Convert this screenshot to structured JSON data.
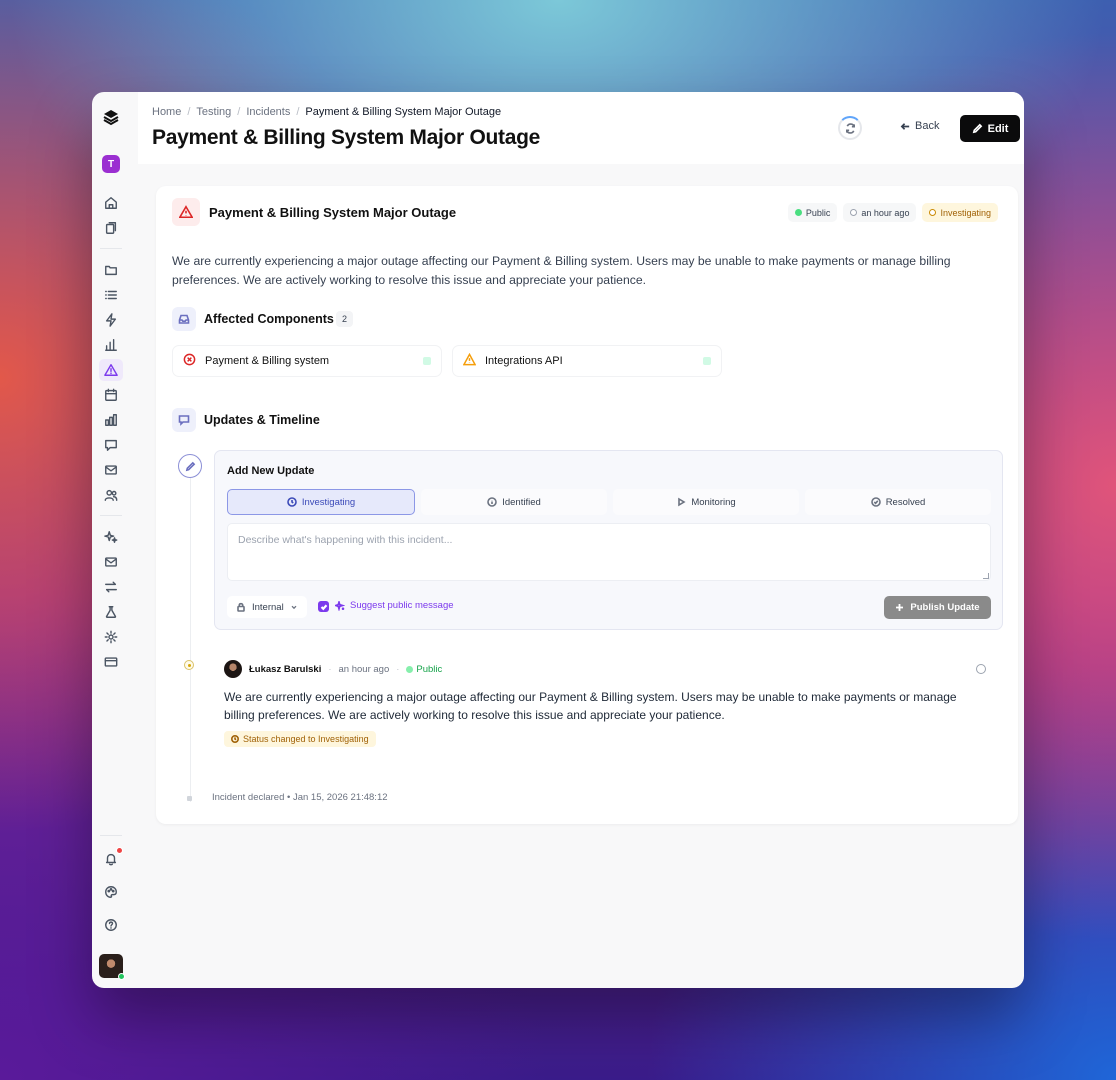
{
  "breadcrumb": [
    "Home",
    "Testing",
    "Incidents",
    "Payment & Billing System Major Outage"
  ],
  "page_title": "Payment & Billing System Major Outage",
  "header": {
    "back_label": "Back",
    "edit_label": "Edit"
  },
  "workspace_initial": "T",
  "incident": {
    "title": "Payment & Billing System Major Outage",
    "visibility": "Public",
    "time_ago": "an hour ago",
    "status": "Investigating",
    "description": "We are currently experiencing a major outage affecting our Payment & Billing system. Users may be unable to make payments or manage billing preferences. We are actively working to resolve this issue and appreciate your patience."
  },
  "affected": {
    "title": "Affected Components",
    "count": "2",
    "items": [
      {
        "name": "Payment & Billing system",
        "icon": "x-circle-icon",
        "color": "#dc2626"
      },
      {
        "name": "Integrations API",
        "icon": "warning-icon",
        "color": "#f59e0b"
      }
    ]
  },
  "timeline": {
    "title": "Updates & Timeline",
    "add_update": {
      "title": "Add New Update",
      "tabs": [
        "Investigating",
        "Identified",
        "Monitoring",
        "Resolved"
      ],
      "placeholder": "Describe what's happening with this incident...",
      "visibility": "Internal",
      "suggest_label": "Suggest public message",
      "publish_label": "Publish Update"
    },
    "entry": {
      "author": "Łukasz Barulski",
      "time": "an hour ago",
      "visibility": "Public",
      "text": "We are currently experiencing a major outage affecting our Payment & Billing system. Users may be unable to make payments or manage billing preferences. We are actively working to resolve this issue and appreciate your patience.",
      "status_change": "Status changed to Investigating"
    },
    "declared": "Incident declared • Jan 15, 2026 21:48:12"
  },
  "colors": {
    "accent": "#7c3aed",
    "danger": "#dc2626",
    "warning": "#a16207",
    "success": "#16a34a"
  }
}
